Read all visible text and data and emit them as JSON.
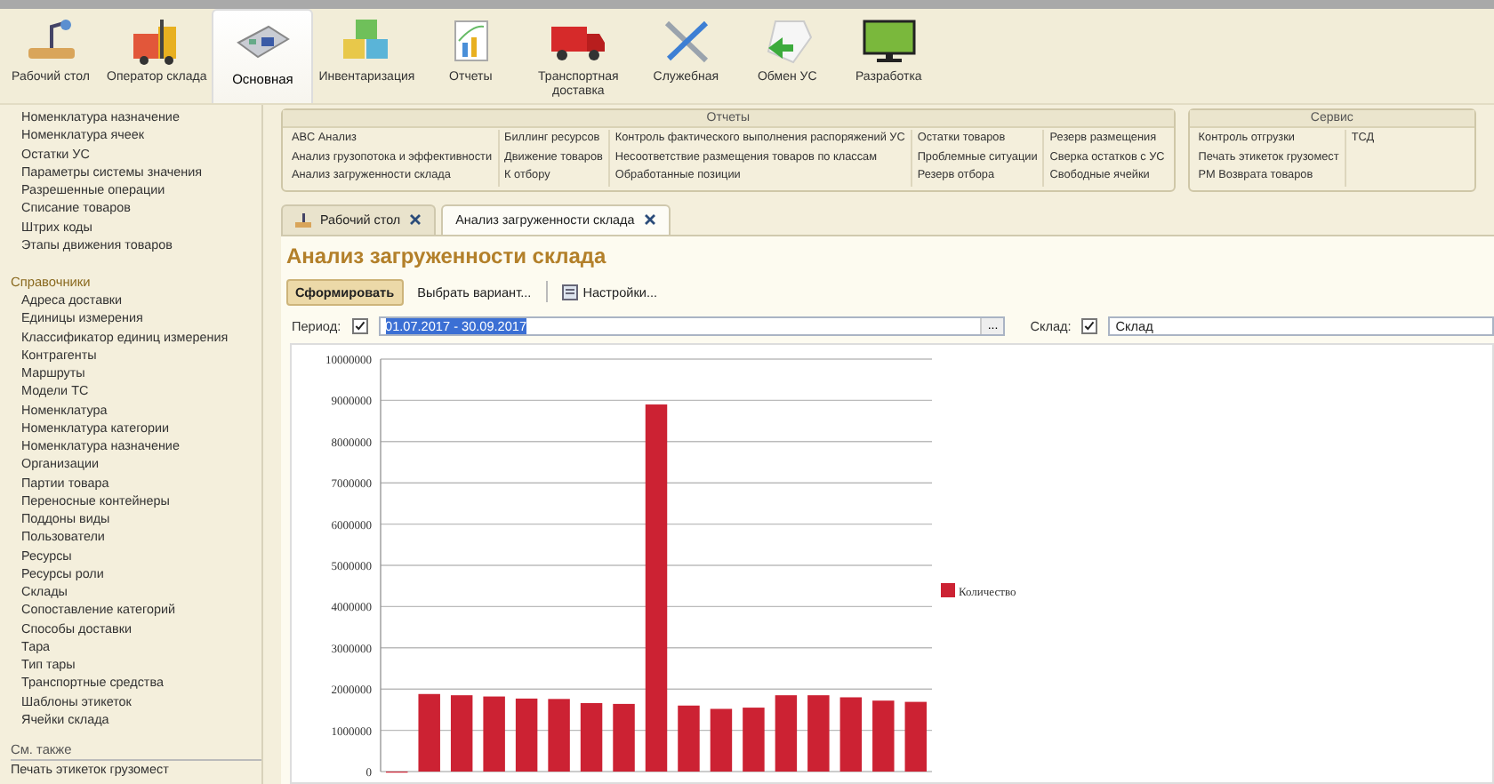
{
  "sections": [
    {
      "label": "Рабочий стол",
      "kind": "desk",
      "selected": false
    },
    {
      "label": "Оператор склада",
      "kind": "loader",
      "selected": false
    },
    {
      "label": "Основная",
      "kind": "board",
      "selected": true
    },
    {
      "label": "Инвентаризация",
      "kind": "cubes",
      "selected": false
    },
    {
      "label": "Отчеты",
      "kind": "report",
      "selected": false
    },
    {
      "label": "Транспортная доставка",
      "kind": "truck",
      "selected": false
    },
    {
      "label": "Служебная",
      "kind": "tools",
      "selected": false
    },
    {
      "label": "Обмен УС",
      "kind": "exchange",
      "selected": false
    },
    {
      "label": "Разработка",
      "kind": "monitor",
      "selected": false
    }
  ],
  "sidebar": {
    "groups": [
      {
        "items": [
          "Номенклатура назначение",
          "Номенклатура ячеек",
          "Остатки УС",
          "Параметры системы значения",
          "Разрешенные операции",
          "Списание товаров",
          "Штрих коды",
          "Этапы движения товаров"
        ]
      },
      {
        "title": "Справочники",
        "items": [
          "Адреса доставки",
          "Единицы измерения",
          "Классификатор единиц измерения",
          "Контрагенты",
          "Маршруты",
          "Модели ТС",
          "Номенклатура",
          "Номенклатура категории",
          "Номенклатура назначение",
          "Организации",
          "Партии товара",
          "Переносные контейнеры",
          "Поддоны виды",
          "Пользователи",
          "Ресурсы",
          "Ресурсы роли",
          "Склады",
          "Сопоставление категорий",
          "Способы доставки",
          "Тара",
          "Тип тары",
          "Транспортные средства",
          "Шаблоны этикеток",
          "Ячейки склада"
        ]
      }
    ],
    "see_also": {
      "title": "См. также",
      "items": [
        "Печать этикеток грузомест"
      ]
    }
  },
  "command_panels": [
    {
      "title": "Отчеты",
      "columns": [
        [
          "ABC Анализ",
          "Анализ грузопотока и эффективности",
          "Анализ загруженности склада"
        ],
        [
          "Биллинг ресурсов",
          "Движение товаров",
          "К отбору"
        ],
        [
          "Контроль фактического выполнения распоряжений УС",
          "Несоответствие размещения товаров по классам",
          "Обработанные позиции"
        ],
        [
          "Остатки товаров",
          "Проблемные ситуации",
          "Резерв отбора"
        ],
        [
          "Резерв размещения",
          "Сверка остатков с УС",
          "Свободные ячейки"
        ]
      ]
    },
    {
      "title": "Сервис",
      "columns": [
        [
          "Контроль отгрузки",
          "Печать этикеток грузомест",
          "РМ Возврата товаров"
        ],
        [
          "ТСД"
        ]
      ]
    }
  ],
  "tabs": [
    {
      "label": "Рабочий стол",
      "selected": false
    },
    {
      "label": "Анализ загруженности склада",
      "selected": true
    }
  ],
  "form": {
    "title": "Анализ загруженности склада",
    "buttons": [
      {
        "label": "Сформировать",
        "kind": "primary"
      },
      {
        "label": "Выбрать вариант...",
        "kind": "plain"
      },
      {
        "label": "Настройки...",
        "kind": "settings"
      }
    ],
    "filters": [
      {
        "label": "Период:",
        "checked": true,
        "value": "01.07.2017 - 30.09.2017",
        "selected": true,
        "kind": "period",
        "button": "..."
      },
      {
        "label": "Склад:",
        "checked": true,
        "value": "Склад",
        "selected": false,
        "kind": "plain"
      }
    ],
    "chart_data": {
      "type": "bar",
      "grid": true,
      "ylim": [
        0,
        10000000
      ],
      "yticks": [
        0,
        1000000,
        2000000,
        3000000,
        4000000,
        5000000,
        6000000,
        7000000,
        8000000,
        9000000,
        10000000
      ],
      "series": [
        {
          "name": "Количество",
          "color": "#cc2233",
          "values": [
            0,
            1880000,
            1850000,
            1820000,
            1770000,
            1760000,
            1660000,
            1640000,
            8900000,
            1600000,
            1520000,
            1550000,
            1850000,
            1850000,
            1800000,
            1720000,
            1690000
          ]
        }
      ]
    }
  }
}
